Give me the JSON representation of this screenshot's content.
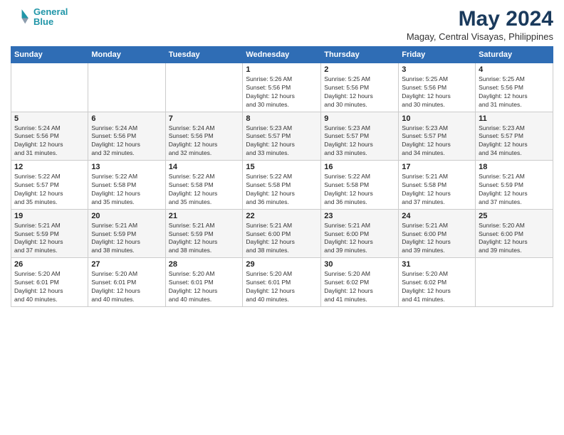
{
  "logo": {
    "line1": "General",
    "line2": "Blue"
  },
  "title": "May 2024",
  "subtitle": "Magay, Central Visayas, Philippines",
  "weekdays": [
    "Sunday",
    "Monday",
    "Tuesday",
    "Wednesday",
    "Thursday",
    "Friday",
    "Saturday"
  ],
  "weeks": [
    [
      {
        "day": "",
        "info": ""
      },
      {
        "day": "",
        "info": ""
      },
      {
        "day": "",
        "info": ""
      },
      {
        "day": "1",
        "info": "Sunrise: 5:26 AM\nSunset: 5:56 PM\nDaylight: 12 hours\nand 30 minutes."
      },
      {
        "day": "2",
        "info": "Sunrise: 5:25 AM\nSunset: 5:56 PM\nDaylight: 12 hours\nand 30 minutes."
      },
      {
        "day": "3",
        "info": "Sunrise: 5:25 AM\nSunset: 5:56 PM\nDaylight: 12 hours\nand 30 minutes."
      },
      {
        "day": "4",
        "info": "Sunrise: 5:25 AM\nSunset: 5:56 PM\nDaylight: 12 hours\nand 31 minutes."
      }
    ],
    [
      {
        "day": "5",
        "info": "Sunrise: 5:24 AM\nSunset: 5:56 PM\nDaylight: 12 hours\nand 31 minutes."
      },
      {
        "day": "6",
        "info": "Sunrise: 5:24 AM\nSunset: 5:56 PM\nDaylight: 12 hours\nand 32 minutes."
      },
      {
        "day": "7",
        "info": "Sunrise: 5:24 AM\nSunset: 5:56 PM\nDaylight: 12 hours\nand 32 minutes."
      },
      {
        "day": "8",
        "info": "Sunrise: 5:23 AM\nSunset: 5:57 PM\nDaylight: 12 hours\nand 33 minutes."
      },
      {
        "day": "9",
        "info": "Sunrise: 5:23 AM\nSunset: 5:57 PM\nDaylight: 12 hours\nand 33 minutes."
      },
      {
        "day": "10",
        "info": "Sunrise: 5:23 AM\nSunset: 5:57 PM\nDaylight: 12 hours\nand 34 minutes."
      },
      {
        "day": "11",
        "info": "Sunrise: 5:23 AM\nSunset: 5:57 PM\nDaylight: 12 hours\nand 34 minutes."
      }
    ],
    [
      {
        "day": "12",
        "info": "Sunrise: 5:22 AM\nSunset: 5:57 PM\nDaylight: 12 hours\nand 35 minutes."
      },
      {
        "day": "13",
        "info": "Sunrise: 5:22 AM\nSunset: 5:58 PM\nDaylight: 12 hours\nand 35 minutes."
      },
      {
        "day": "14",
        "info": "Sunrise: 5:22 AM\nSunset: 5:58 PM\nDaylight: 12 hours\nand 35 minutes."
      },
      {
        "day": "15",
        "info": "Sunrise: 5:22 AM\nSunset: 5:58 PM\nDaylight: 12 hours\nand 36 minutes."
      },
      {
        "day": "16",
        "info": "Sunrise: 5:22 AM\nSunset: 5:58 PM\nDaylight: 12 hours\nand 36 minutes."
      },
      {
        "day": "17",
        "info": "Sunrise: 5:21 AM\nSunset: 5:58 PM\nDaylight: 12 hours\nand 37 minutes."
      },
      {
        "day": "18",
        "info": "Sunrise: 5:21 AM\nSunset: 5:59 PM\nDaylight: 12 hours\nand 37 minutes."
      }
    ],
    [
      {
        "day": "19",
        "info": "Sunrise: 5:21 AM\nSunset: 5:59 PM\nDaylight: 12 hours\nand 37 minutes."
      },
      {
        "day": "20",
        "info": "Sunrise: 5:21 AM\nSunset: 5:59 PM\nDaylight: 12 hours\nand 38 minutes."
      },
      {
        "day": "21",
        "info": "Sunrise: 5:21 AM\nSunset: 5:59 PM\nDaylight: 12 hours\nand 38 minutes."
      },
      {
        "day": "22",
        "info": "Sunrise: 5:21 AM\nSunset: 6:00 PM\nDaylight: 12 hours\nand 38 minutes."
      },
      {
        "day": "23",
        "info": "Sunrise: 5:21 AM\nSunset: 6:00 PM\nDaylight: 12 hours\nand 39 minutes."
      },
      {
        "day": "24",
        "info": "Sunrise: 5:21 AM\nSunset: 6:00 PM\nDaylight: 12 hours\nand 39 minutes."
      },
      {
        "day": "25",
        "info": "Sunrise: 5:20 AM\nSunset: 6:00 PM\nDaylight: 12 hours\nand 39 minutes."
      }
    ],
    [
      {
        "day": "26",
        "info": "Sunrise: 5:20 AM\nSunset: 6:01 PM\nDaylight: 12 hours\nand 40 minutes."
      },
      {
        "day": "27",
        "info": "Sunrise: 5:20 AM\nSunset: 6:01 PM\nDaylight: 12 hours\nand 40 minutes."
      },
      {
        "day": "28",
        "info": "Sunrise: 5:20 AM\nSunset: 6:01 PM\nDaylight: 12 hours\nand 40 minutes."
      },
      {
        "day": "29",
        "info": "Sunrise: 5:20 AM\nSunset: 6:01 PM\nDaylight: 12 hours\nand 40 minutes."
      },
      {
        "day": "30",
        "info": "Sunrise: 5:20 AM\nSunset: 6:02 PM\nDaylight: 12 hours\nand 41 minutes."
      },
      {
        "day": "31",
        "info": "Sunrise: 5:20 AM\nSunset: 6:02 PM\nDaylight: 12 hours\nand 41 minutes."
      },
      {
        "day": "",
        "info": ""
      }
    ]
  ]
}
